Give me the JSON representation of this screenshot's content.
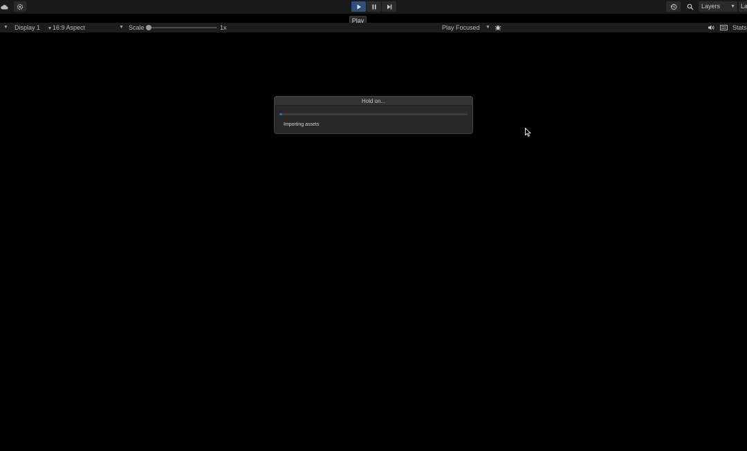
{
  "toolbar": {
    "icons": {
      "cloud": "cloud-icon",
      "settings": "gear-icon",
      "play": "play-icon",
      "pause": "pause-icon",
      "step": "step-icon",
      "history": "history-icon",
      "search": "search-icon"
    },
    "play_tooltip": "Play",
    "layers_label": "Layers",
    "layout_label": "La"
  },
  "game_view": {
    "display": "Display 1",
    "aspect": "16:9 Aspect",
    "scale_label": "Scale",
    "scale_value": "1x",
    "play_mode": "Play Focused",
    "stats_label": "Stats"
  },
  "dialog": {
    "title": "Hold on...",
    "status": "Importing assets",
    "progress": 0.01
  },
  "colors": {
    "accent": "#2d4f7e",
    "progress": "#2f6ad0",
    "background": "#000000"
  }
}
